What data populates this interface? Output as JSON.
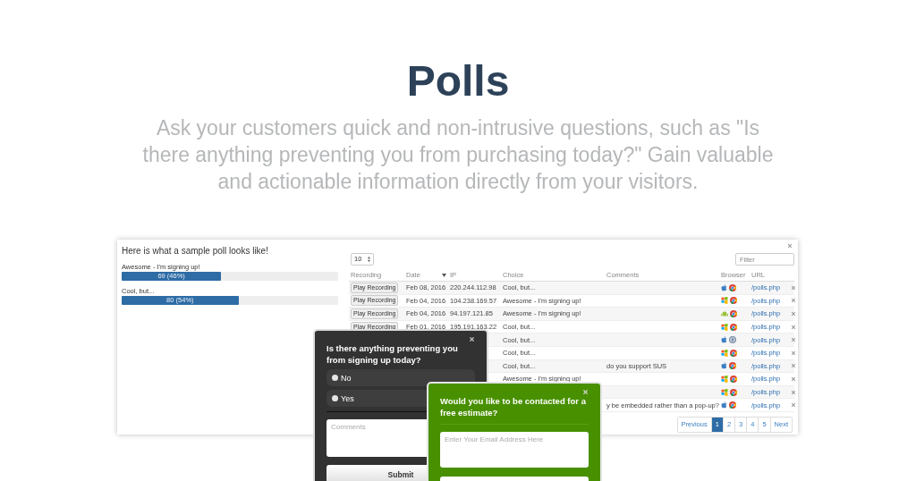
{
  "header": {
    "title": "Polls",
    "subtitle": "Ask your customers quick and non-intrusive questions, such as \"Is there anything preventing you from purchasing today?\" Gain valuable and actionable information directly from your visitors."
  },
  "sample_poll": {
    "title": "Here is what a sample poll looks like!",
    "results": [
      {
        "label": "Awesome - I'm signing up!",
        "reading": "69 (46%)",
        "level": 0.46
      },
      {
        "label": "Cool, but...",
        "reading": "80 (54%)",
        "level": 0.54
      }
    ]
  },
  "table": {
    "page_size": "10",
    "filter_placeholder": "Filter",
    "columns": [
      "Recording",
      "Date",
      "IP",
      "Choice",
      "Comments",
      "Browser",
      "URL"
    ],
    "rows": [
      {
        "recording": "Play Recording",
        "date": "Feb 08, 2016",
        "ip": "220.244.112.98",
        "choice": "Cool, but...",
        "icons": [
          {
            "kind": "mac"
          },
          {
            "kind": "chrome"
          }
        ],
        "url": "/polls.php"
      },
      {
        "recording": "Play Recording",
        "date": "Feb 04, 2016",
        "ip": "104.238.169.57",
        "choice": "Awesome - I'm signing up!",
        "icons": [
          {
            "kind": "windows"
          },
          {
            "kind": "chrome"
          }
        ],
        "url": "/polls.php"
      },
      {
        "recording": "Play Recording",
        "date": "Feb 04, 2016",
        "ip": "94.197.121.85",
        "choice": "Awesome - I'm signing up!",
        "icons": [
          {
            "kind": "android"
          },
          {
            "kind": "chrome"
          }
        ],
        "url": "/polls.php"
      },
      {
        "recording": "Play Recording",
        "date": "Feb 01, 2016",
        "ip": "195.191.163.22",
        "choice": "Cool, but...",
        "icons": [
          {
            "kind": "windows"
          },
          {
            "kind": "chrome"
          }
        ],
        "url": "/polls.php"
      },
      {
        "choice": "Cool, but...",
        "icons": [
          {
            "kind": "mac"
          },
          {
            "kind": "safari"
          }
        ],
        "url": "/polls.php"
      },
      {
        "choice": "Cool, but...",
        "icons": [
          {
            "kind": "windows"
          },
          {
            "kind": "chrome"
          }
        ],
        "url": "/polls.php"
      },
      {
        "choice": "Cool, but...",
        "comment": "do you support SUS",
        "icons": [
          {
            "kind": "mac"
          },
          {
            "kind": "chrome"
          }
        ],
        "url": "/polls.php"
      },
      {
        "choice": "Awesome - I'm signing up!",
        "icons": [
          {
            "kind": "windows"
          },
          {
            "kind": "chrome"
          }
        ],
        "url": "/polls.php"
      },
      {
        "icons": [
          {
            "kind": "windows"
          },
          {
            "kind": "chrome"
          }
        ],
        "url": "/polls.php"
      },
      {
        "comment": "y be embedded rather than a pop-up?",
        "icons": [
          {
            "kind": "mac"
          },
          {
            "kind": "chrome"
          }
        ],
        "url": "/polls.php"
      }
    ],
    "pagination": [
      {
        "label": "Previous",
        "selected": false
      },
      {
        "label": "1",
        "selected": true
      },
      {
        "label": "2",
        "selected": false
      },
      {
        "label": "3",
        "selected": false
      },
      {
        "label": "4",
        "selected": false
      },
      {
        "label": "5",
        "selected": false
      },
      {
        "label": "Next",
        "selected": false
      }
    ]
  },
  "dark_popup": {
    "question": "Is there anything preventing you from signing up today?",
    "options": [
      {
        "label": "No",
        "selected": false
      },
      {
        "label": "Yes",
        "selected": false
      }
    ],
    "comments_placeholder": "Comments",
    "submit": "Submit"
  },
  "green_popup": {
    "question": "Would you like to be contacted for a free estimate?",
    "email_placeholder": "Enter Your Email Address Here"
  }
}
